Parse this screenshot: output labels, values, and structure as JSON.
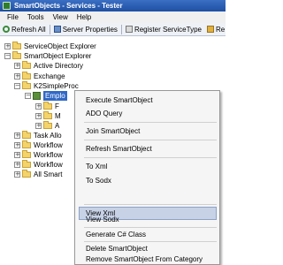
{
  "window": {
    "title": "SmartObjects - Services - Tester"
  },
  "menubar": {
    "items": [
      "File",
      "Tools",
      "View",
      "Help"
    ]
  },
  "toolbar": {
    "refresh_all": "Refresh All",
    "server_properties": "Server Properties",
    "register_service_type": "Register ServiceType",
    "register": "Re"
  },
  "tree": {
    "nodes": [
      {
        "label": "ServiceObject Explorer",
        "expander": "+"
      },
      {
        "label": "SmartObject Explorer",
        "expander": "−"
      },
      {
        "label": "Active Directory",
        "expander": "+"
      },
      {
        "label": "Exchange",
        "expander": "+"
      },
      {
        "label": "K2SimpleProc",
        "expander": "−"
      },
      {
        "label": "Emplo",
        "expander": "−"
      },
      {
        "label": "F",
        "expander": "+"
      },
      {
        "label": "M",
        "expander": "+"
      },
      {
        "label": "A",
        "expander": "+"
      },
      {
        "label": "Task Allo",
        "expander": "+"
      },
      {
        "label": "Workflow",
        "expander": "+"
      },
      {
        "label": "Workflow",
        "expander": "+"
      },
      {
        "label": "Workflow",
        "expander": "+"
      },
      {
        "label": "All Smart",
        "expander": "+"
      }
    ]
  },
  "context_menu": {
    "items": [
      "Execute SmartObject",
      "ADO Query",
      "Join SmartObject",
      "Refresh SmartObject",
      "To Xml",
      "To Sodx",
      "View Xml",
      "View Sodx",
      "Generate C# Class",
      "Delete SmartObject",
      "Remove SmartObject  From Category"
    ],
    "highlighted": "View Xml"
  }
}
